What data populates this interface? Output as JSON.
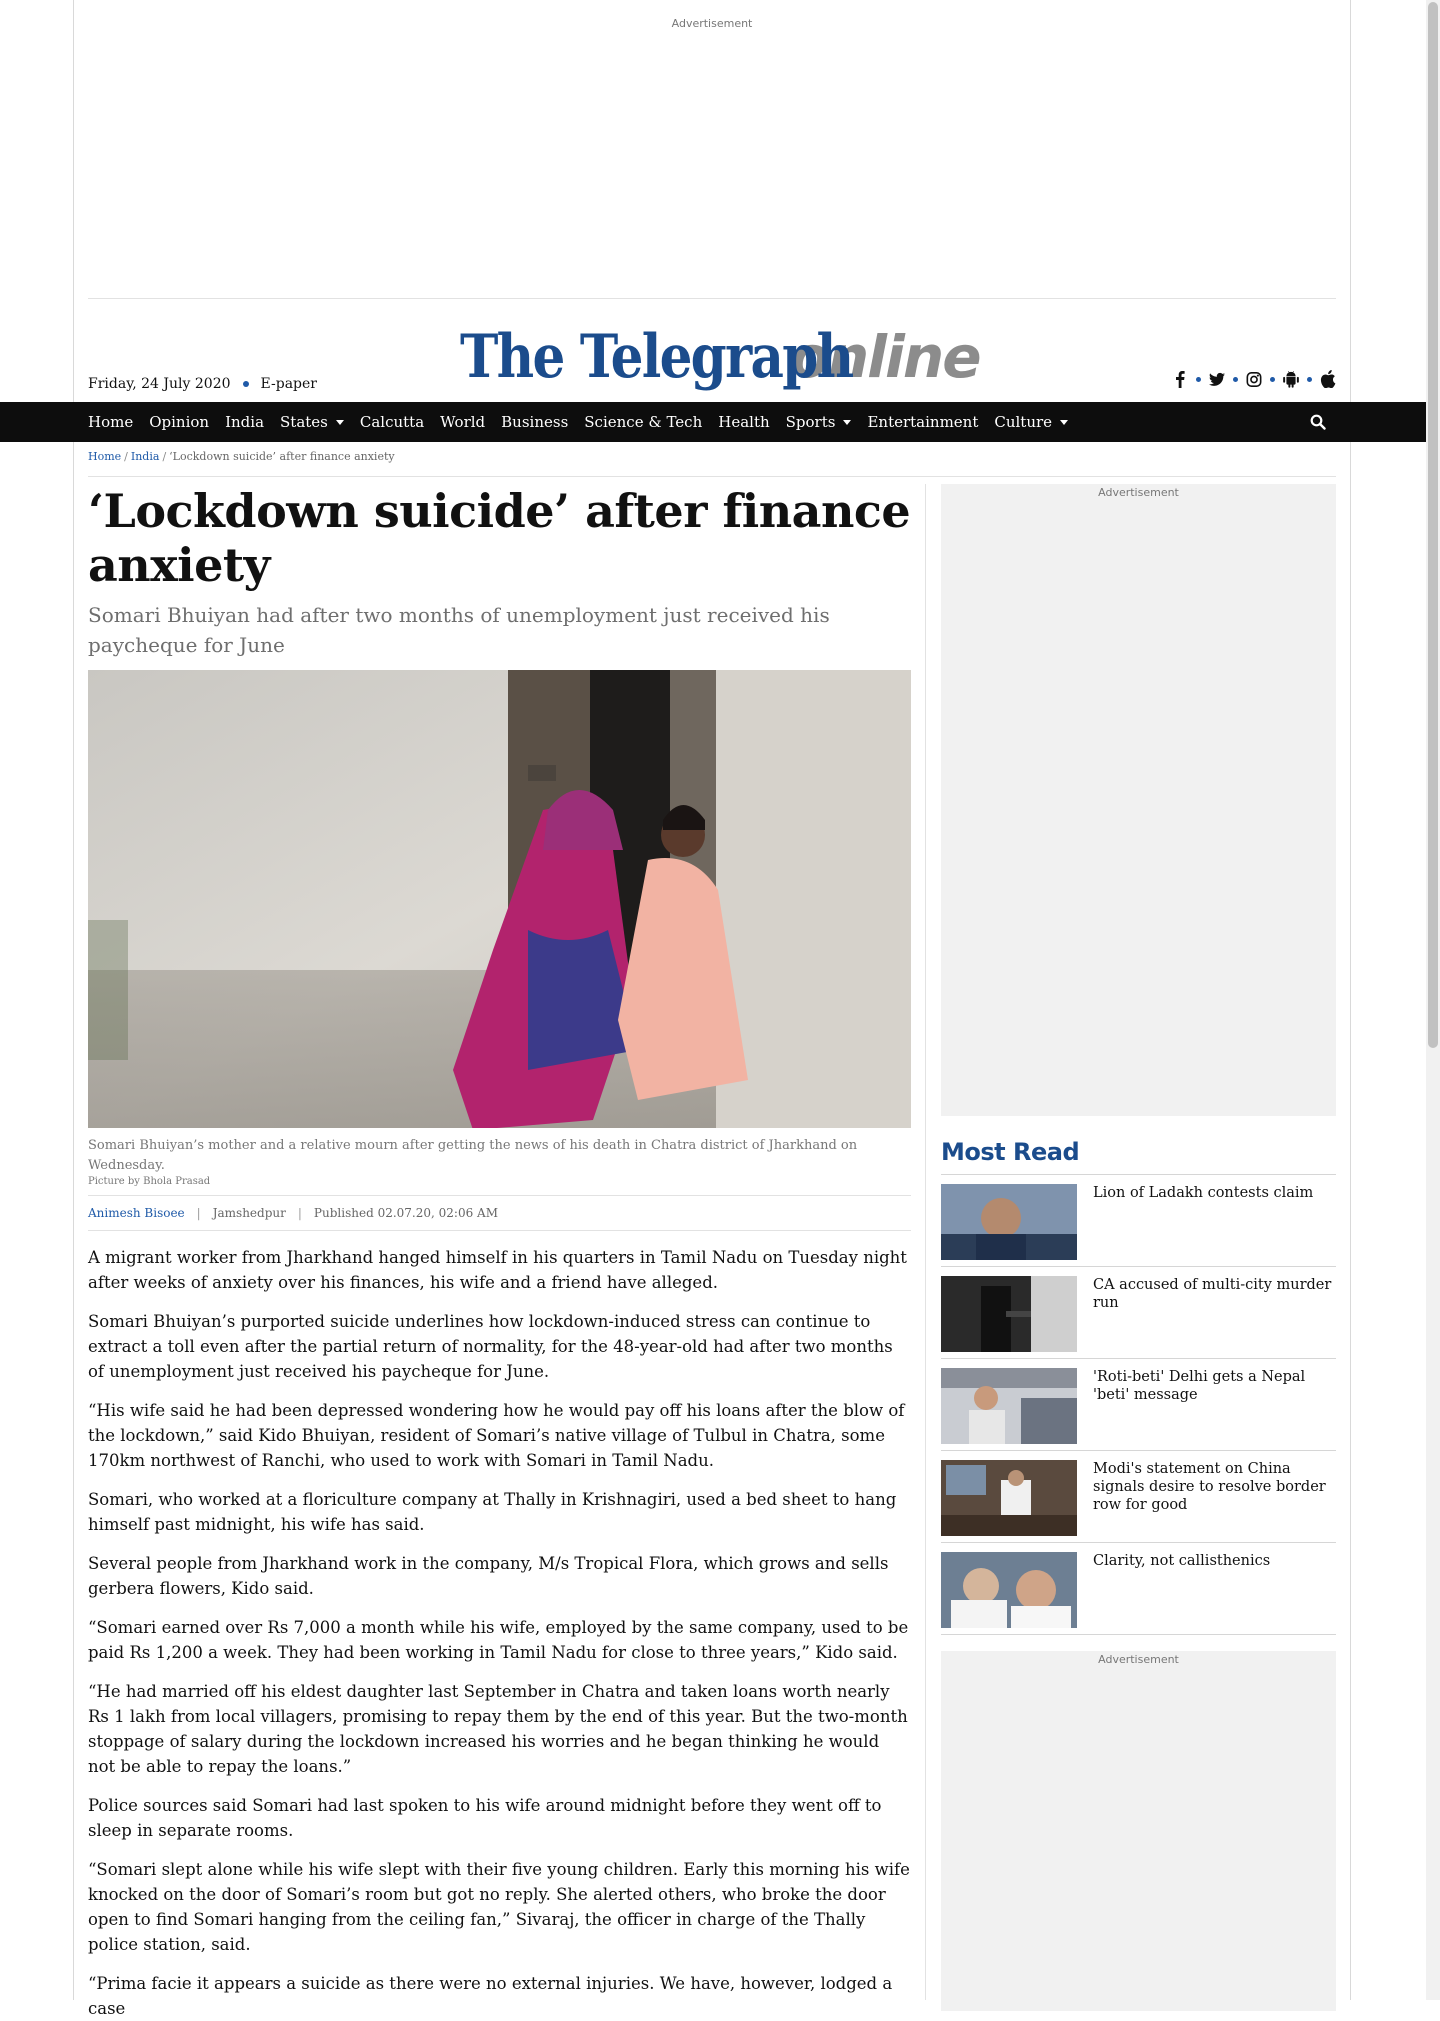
{
  "top_ad": {
    "label": "Advertisement"
  },
  "masthead": {
    "date": "Friday, 24 July 2020",
    "epaper": "E-paper",
    "logo_part1": "The Telegraph",
    "logo_part2": "online"
  },
  "social_icons": [
    "facebook-icon",
    "twitter-icon",
    "instagram-icon",
    "android-icon",
    "apple-icon"
  ],
  "nav": {
    "items": [
      {
        "label": "Home",
        "dropdown": false
      },
      {
        "label": "Opinion",
        "dropdown": false
      },
      {
        "label": "India",
        "dropdown": false
      },
      {
        "label": "States",
        "dropdown": true
      },
      {
        "label": "Calcutta",
        "dropdown": false
      },
      {
        "label": "World",
        "dropdown": false
      },
      {
        "label": "Business",
        "dropdown": false
      },
      {
        "label": "Science & Tech",
        "dropdown": false
      },
      {
        "label": "Health",
        "dropdown": false
      },
      {
        "label": "Sports",
        "dropdown": true
      },
      {
        "label": "Entertainment",
        "dropdown": false
      },
      {
        "label": "Culture",
        "dropdown": true
      }
    ]
  },
  "breadcrumb": {
    "home": "Home",
    "section": "India",
    "current": "‘Lockdown suicide’ after finance anxiety"
  },
  "article": {
    "headline": "‘Lockdown suicide’ after finance anxiety",
    "subhead": "Somari Bhuiyan had after two months of unemployment just received his paycheque for June",
    "caption": "Somari Bhuiyan’s mother and a relative mourn after getting the news of his death in Chatra district of Jharkhand on Wednesday.",
    "credit": "Picture by Bhola Prasad",
    "author": "Animesh Bisoee",
    "location": "Jamshedpur",
    "published": "Published 02.07.20, 02:06 AM",
    "paragraphs": [
      "A migrant worker from Jharkhand hanged himself in his quarters in Tamil Nadu on Tuesday night after weeks of anxiety over his finances, his wife and a friend have alleged.",
      "Somari Bhuiyan’s purported suicide underlines how lockdown-induced stress can continue to extract a toll even after the partial return of normality, for the 48-year-old had after two months of unemployment just received his paycheque for June.",
      "“His wife said he had been depressed wondering how he would pay off his loans after the blow of the lockdown,” said Kido Bhuiyan, resident of Somari’s native village of Tulbul in Chatra, some 170km northwest of Ranchi, who used to work with Somari in Tamil Nadu.",
      "Somari, who worked at a floriculture company at Thally in Krishnagiri, used a bed sheet to hang himself past midnight, his wife has said.",
      "Several people from Jharkhand work in the company, M/s Tropical Flora, which grows and sells gerbera flowers, Kido said.",
      "“Somari earned over Rs 7,000 a month while his wife, employed by the same company, used to be paid Rs 1,200 a week. They had been working in Tamil Nadu for close to three years,” Kido said.",
      "“He had married off his eldest daughter last September in Chatra and taken loans worth nearly Rs 1 lakh from local villagers, promising to repay them by the end of this year. But the two-month stoppage of salary during the lockdown increased his worries and he began thinking he would not be able to repay the loans.”",
      "Police sources said Somari had last spoken to his wife around midnight before they went off to sleep in separate rooms.",
      "“Somari slept alone while his wife slept with their five young children. Early this morning his wife knocked on the door of Somari’s room but got no reply. She alerted others, who broke the door open to find Somari hanging from the ceiling fan,” Sivaraj, the officer in charge of the Thally police station, said.",
      "“Prima facie it appears a suicide as there were no external injuries. We have, however, lodged a case"
    ]
  },
  "sidebar": {
    "ad_label": "Advertisement",
    "most_read_title": "Most Read",
    "most_read": [
      {
        "title": "Lion of Ladakh contests claim"
      },
      {
        "title": "CA accused of multi-city murder run"
      },
      {
        "title": "'Roti-beti' Delhi gets a Nepal 'beti' message"
      },
      {
        "title": "Modi's statement on China signals desire to resolve border row for good"
      },
      {
        "title": "Clarity, not callisthenics"
      }
    ],
    "ad2_label": "Advertisement"
  },
  "colors": {
    "brand_blue": "#1b4c8c",
    "link_blue": "#1f5aa8",
    "nav_bg": "#0d0d0d",
    "logo_grey": "#8c8c8c"
  }
}
